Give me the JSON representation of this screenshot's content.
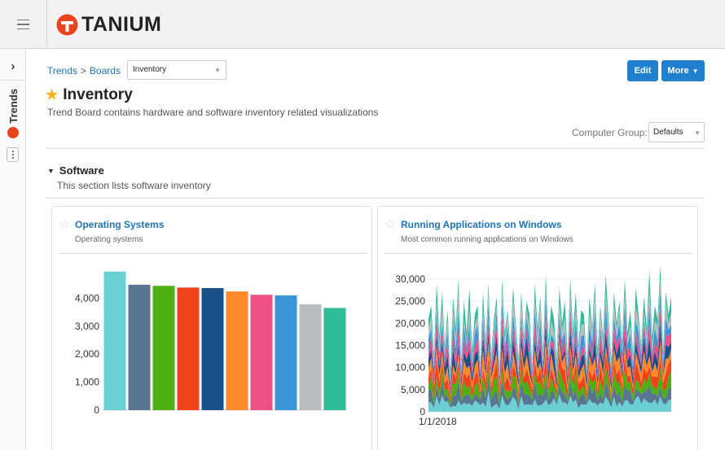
{
  "header": {
    "brand": "TANIUM",
    "brand_color": "#e8451e"
  },
  "rail": {
    "label": "Trends",
    "toggle_icon": "chevron-right-icon",
    "more_icon": "more-vertical-icon"
  },
  "breadcrumb": {
    "trends": "Trends",
    "sep": ">",
    "boards": "Boards"
  },
  "board_select": {
    "value": "Inventory"
  },
  "toolbar": {
    "edit_label": "Edit",
    "more_label": "More"
  },
  "page": {
    "title": "Inventory",
    "description": "Trend Board contains hardware and software inventory related visualizations"
  },
  "computer_group": {
    "label": "Computer Group:",
    "value": "Defaults"
  },
  "section": {
    "title": "Software",
    "description": "This section lists software inventory"
  },
  "cards": [
    {
      "title": "Operating Systems",
      "subtitle": "Operating systems"
    },
    {
      "title": "Running Applications on Windows",
      "subtitle": "Most common running applications on Windows"
    }
  ],
  "colors": {
    "accent": "#1f80d0",
    "link": "#1f73b7",
    "star": "#f3b417"
  },
  "chart_data": [
    {
      "type": "bar",
      "title": "",
      "ylim": [
        0,
        5000
      ],
      "yticks": [
        0,
        1000,
        2000,
        3000,
        4000
      ],
      "ytick_labels": [
        "0",
        "1,000",
        "2,000",
        "3,000",
        "4,000"
      ],
      "values": [
        4950,
        4480,
        4440,
        4380,
        4360,
        4240,
        4120,
        4100,
        3780,
        3650
      ],
      "colors": [
        "#6ccfd6",
        "#5a7591",
        "#4caf14",
        "#f0421c",
        "#1a4f8a",
        "#fd8a2a",
        "#ee4f87",
        "#3a95d8",
        "#b8bdc2",
        "#2fba98"
      ],
      "grid": false
    },
    {
      "type": "area",
      "title": "",
      "ylim": [
        0,
        32000
      ],
      "yticks": [
        0,
        5000,
        10000,
        15000,
        20000,
        25000,
        30000
      ],
      "ytick_labels": [
        "0",
        "5,000",
        "10,000",
        "15,000",
        "20,000",
        "25,000",
        "30,000"
      ],
      "x_start_label": "1/1/2018",
      "stacked": true,
      "series_colors": [
        "#6ccfd6",
        "#5a7591",
        "#4caf14",
        "#f0421c",
        "#fd8a2a",
        "#1a4f8a",
        "#ee4f87",
        "#3a95d8",
        "#b8bdc2",
        "#2fba98"
      ],
      "totals": [
        21000,
        24000,
        13000,
        29000,
        17000,
        27000,
        15000,
        23000,
        9000,
        26000,
        19000,
        30000,
        12000,
        25000,
        18000,
        28000,
        14000,
        22000,
        24000,
        11000,
        27000,
        16000,
        29000,
        13000,
        21000,
        26000,
        10000,
        30000,
        18000,
        23000,
        15000,
        28000,
        20000,
        12000,
        27000,
        17000,
        25000,
        22000,
        11000,
        29000,
        19000,
        26000,
        14000,
        31000,
        16000,
        24000,
        21000,
        12000,
        28000,
        20000,
        25000,
        13000,
        30000,
        18000,
        27000,
        15000,
        23000,
        22000,
        11000,
        26000,
        19000,
        29000,
        14000,
        24000,
        17000,
        31000,
        21000,
        12000,
        27000,
        20000,
        25000,
        16000,
        30000,
        18000,
        23000,
        13000,
        28000,
        22000,
        15000,
        26000,
        19000,
        32000,
        17000,
        24000,
        21000,
        33000,
        14000,
        27000,
        22000,
        26000
      ]
    }
  ]
}
